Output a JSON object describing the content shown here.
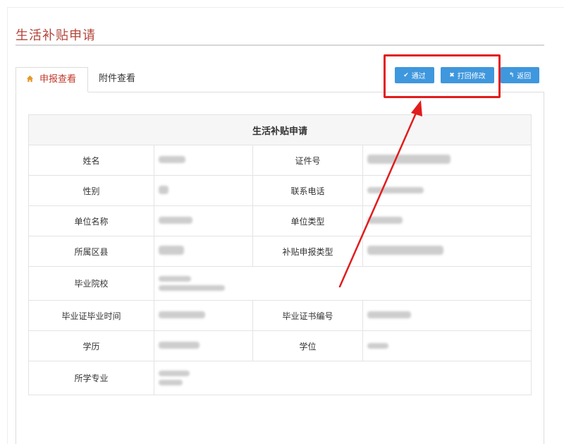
{
  "page": {
    "title": "生活补贴申请"
  },
  "tabs": [
    {
      "label": "申报查看"
    },
    {
      "label": "附件查看"
    }
  ],
  "toolbar": {
    "pass_label": "通过",
    "reject_label": "打回修改",
    "back_label": "返回"
  },
  "form": {
    "title": "生活补贴申请",
    "fields": {
      "name": "姓名",
      "id_number": "证件号",
      "gender": "性别",
      "phone": "联系电话",
      "employer": "单位名称",
      "employer_type": "单位类型",
      "district": "所属区县",
      "subsidy_type": "补贴申报类型",
      "school": "毕业院校",
      "grad_date": "毕业证毕业时间",
      "cert_number": "毕业证书编号",
      "education": "学历",
      "degree": "学位",
      "major": "所学专业"
    }
  },
  "colors": {
    "accent": "#b3453a",
    "button": "#3f97dd",
    "annotation": "#e21c1c"
  },
  "icons": {
    "home": "home-icon",
    "pass": "check-icon",
    "reject": "x-icon",
    "back": "back-arrow-icon"
  }
}
